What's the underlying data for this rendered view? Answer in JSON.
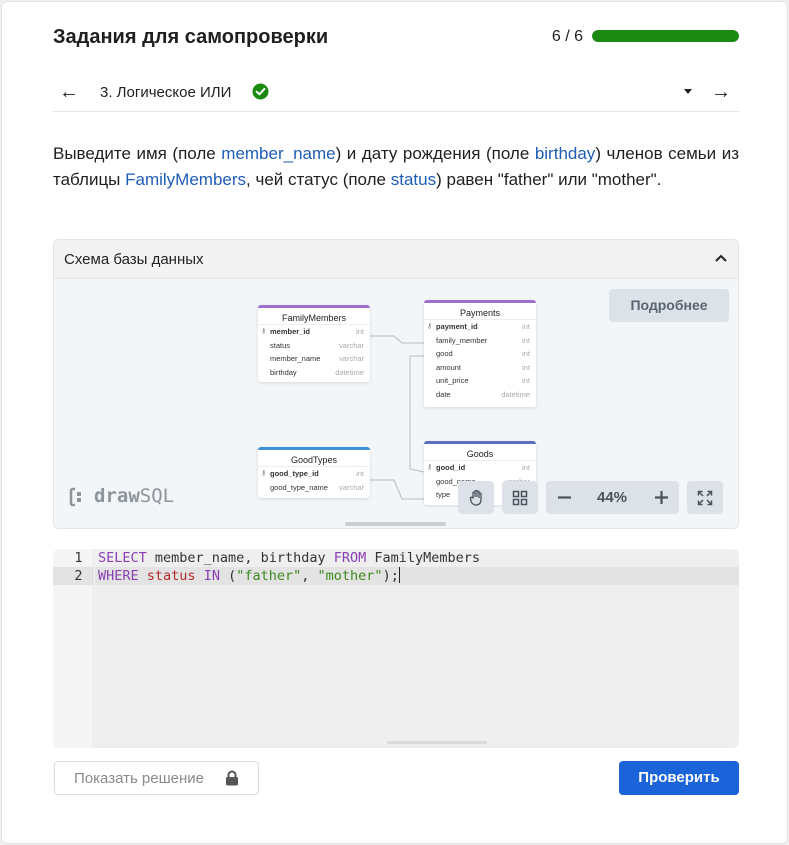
{
  "header": {
    "title": "Задания для самопроверки",
    "progress_text": "6 / 6",
    "progress_fraction": 1.0,
    "progress_color": "#1a8a12"
  },
  "nav": {
    "prev_arrow": "←",
    "next_arrow": "→",
    "task_title": "3. Логическое ИЛИ",
    "check_color": "#1a8a12"
  },
  "task": {
    "parts": [
      "Выведите имя (поле ",
      "member_name",
      ") и дату рождения (поле ",
      "birthday",
      ") членов семьи из таблицы ",
      "FamilyMembers",
      ", чей статус (поле ",
      "status",
      ") равен \"father\" или \"mother\"."
    ]
  },
  "schema": {
    "title": "Схема базы данных",
    "more_button": "Подробнее",
    "logo_text_bold": "draw",
    "logo_text": "SQL",
    "zoom": "44%",
    "tables": [
      {
        "name": "FamilyMembers",
        "rows": [
          {
            "col": "member_id",
            "type": "int",
            "pk": true
          },
          {
            "col": "status",
            "type": "varchar"
          },
          {
            "col": "member_name",
            "type": "varchar"
          },
          {
            "col": "birthday",
            "type": "datetime"
          }
        ]
      },
      {
        "name": "Payments",
        "rows": [
          {
            "col": "payment_id",
            "type": "int",
            "pk": true
          },
          {
            "col": "family_member",
            "type": "int"
          },
          {
            "col": "good",
            "type": "int"
          },
          {
            "col": "amount",
            "type": "int"
          },
          {
            "col": "unit_price",
            "type": "int"
          },
          {
            "col": "date",
            "type": "datetime"
          }
        ]
      },
      {
        "name": "GoodTypes",
        "rows": [
          {
            "col": "good_type_id",
            "type": "int",
            "pk": true
          },
          {
            "col": "good_type_name",
            "type": "varchar"
          }
        ]
      },
      {
        "name": "Goods",
        "rows": [
          {
            "col": "good_id",
            "type": "int",
            "pk": true
          },
          {
            "col": "good_name",
            "type": "varchar"
          },
          {
            "col": "type",
            "type": "int"
          }
        ]
      }
    ]
  },
  "editor": {
    "line_numbers": [
      "1",
      "2"
    ],
    "line1": {
      "kw1": "SELECT",
      "t1": " member_name, birthday ",
      "kw2": "FROM",
      "t2": " FamilyMembers"
    },
    "line2": {
      "kw1": "WHERE",
      "t1": " ",
      "fn": "status",
      "t2": " ",
      "kw2": "IN",
      "t3": " (",
      "s1": "\"father\"",
      "t4": ", ",
      "s2": "\"mother\"",
      "t5": ");"
    }
  },
  "footer": {
    "solution_button": "Показать решение",
    "check_button": "Проверить"
  },
  "colors": {
    "link": "#1f5db8",
    "primary": "#1b63d9"
  }
}
